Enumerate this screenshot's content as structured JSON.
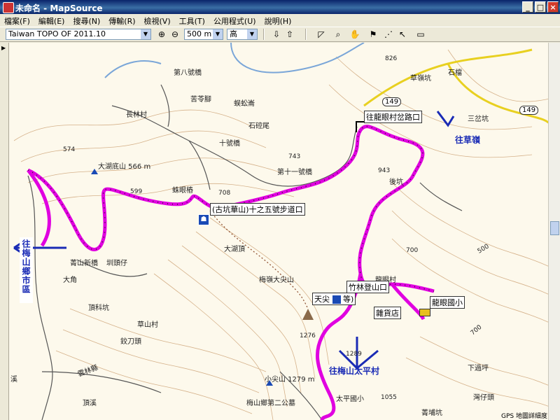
{
  "window": {
    "title": "未命名 - MapSource",
    "minimize": "_",
    "maximize": "□",
    "close": "×"
  },
  "menu": [
    "檔案(F)",
    "編輯(E)",
    "搜尋(N)",
    "傳輸(R)",
    "檢視(V)",
    "工具(T)",
    "公用程式(U)",
    "說明(H)"
  ],
  "toolbar": {
    "map_product": "Taiwan TOPO OF 2011.10",
    "zoom_scale": "500 m",
    "detail_level": "高",
    "icons": [
      "zoom-in-icon",
      "zoom-out-icon",
      "receive-from-device-icon",
      "send-to-device-icon",
      "selection-tool-icon",
      "zoom-tool-icon",
      "hand-tool-icon",
      "waypoint-tool-icon",
      "route-tool-icon",
      "pointer-tool-icon",
      "measure-tool-icon"
    ]
  },
  "map": {
    "place_labels": [
      {
        "id": "changyuan",
        "text": "長林村"
      },
      {
        "id": "di8",
        "text": "第八號橋"
      },
      {
        "id": "kuting",
        "text": "苦苓腳"
      },
      {
        "id": "wugong",
        "text": "蜈蚣崙"
      },
      {
        "id": "shikeng",
        "text": "石硿尾"
      },
      {
        "id": "di10",
        "text": "十號橋"
      },
      {
        "id": "di11",
        "text": "第十一號橋"
      },
      {
        "id": "dahu",
        "text": "大湖底山 566 m"
      },
      {
        "id": "wenshan",
        "text": "蛛眼樁"
      },
      {
        "id": "dahuding",
        "text": "大湖頂"
      },
      {
        "id": "meishan",
        "text": "梅嶺大尖山"
      },
      {
        "id": "ximei",
        "text": "菁山新橋"
      },
      {
        "id": "jiangjun",
        "text": "圳頭仔"
      },
      {
        "id": "dingkeng",
        "text": "頂科坑"
      },
      {
        "id": "dajiao",
        "text": "大角"
      },
      {
        "id": "caopu",
        "text": "草山村"
      },
      {
        "id": "fenshui",
        "text": "鉸刀頭"
      },
      {
        "id": "yunlin",
        "text": "雲林縣"
      },
      {
        "id": "dingxi",
        "text": "頂溪"
      },
      {
        "id": "xiaojianshan",
        "text": "小尖山 1279 m"
      },
      {
        "id": "meishan_park",
        "text": "梅山鄉第二公墓"
      },
      {
        "id": "taiping_school",
        "text": "太平國小"
      },
      {
        "id": "houyan",
        "text": "後坑"
      },
      {
        "id": "sanyoukeng",
        "text": "三岔坑"
      },
      {
        "id": "jiaoyan",
        "text": "石檔"
      },
      {
        "id": "caotou",
        "text": "草嶺坑"
      },
      {
        "id": "xiaguo",
        "text": "下過坪"
      },
      {
        "id": "wanzai",
        "text": "灣仔頭"
      },
      {
        "id": "yingtan",
        "text": "菁埔坑"
      },
      {
        "id": "xikeng",
        "text": "溪"
      },
      {
        "id": "longyan_ping",
        "text": "龍眼村"
      }
    ],
    "elevations": [
      "826",
      "574",
      "599",
      "708",
      "743",
      "943",
      "700",
      "500",
      "700",
      "1276",
      "1055",
      "1289"
    ],
    "waypoint_labels": [
      {
        "id": "longyan_junction",
        "text": "往龍眼村岔路口"
      },
      {
        "id": "trail_entrance",
        "text": "(古坑華山)十之五號步道口"
      },
      {
        "id": "zhulin_trailhead",
        "text": "竹林登山口"
      },
      {
        "id": "tianjian",
        "text": "天尖",
        "suffix": "等)"
      },
      {
        "id": "grocery",
        "text": "雜貨店"
      },
      {
        "id": "longyan_school",
        "text": "龍眼國小"
      }
    ],
    "directions": [
      {
        "id": "to_caoling",
        "text": "往草嶺"
      },
      {
        "id": "to_meishan_town",
        "text": "往梅山鄉市區"
      },
      {
        "id": "to_taiping",
        "text": "往梅山太平村"
      }
    ],
    "road_shields": [
      "149",
      "149"
    ],
    "status_text": "GPS 地圖詳細度",
    "colors": {
      "track": "#e000e0",
      "direction_arrow": "#1a2bb5",
      "contour": "#c89a6a",
      "highway": "#f0e040"
    }
  }
}
